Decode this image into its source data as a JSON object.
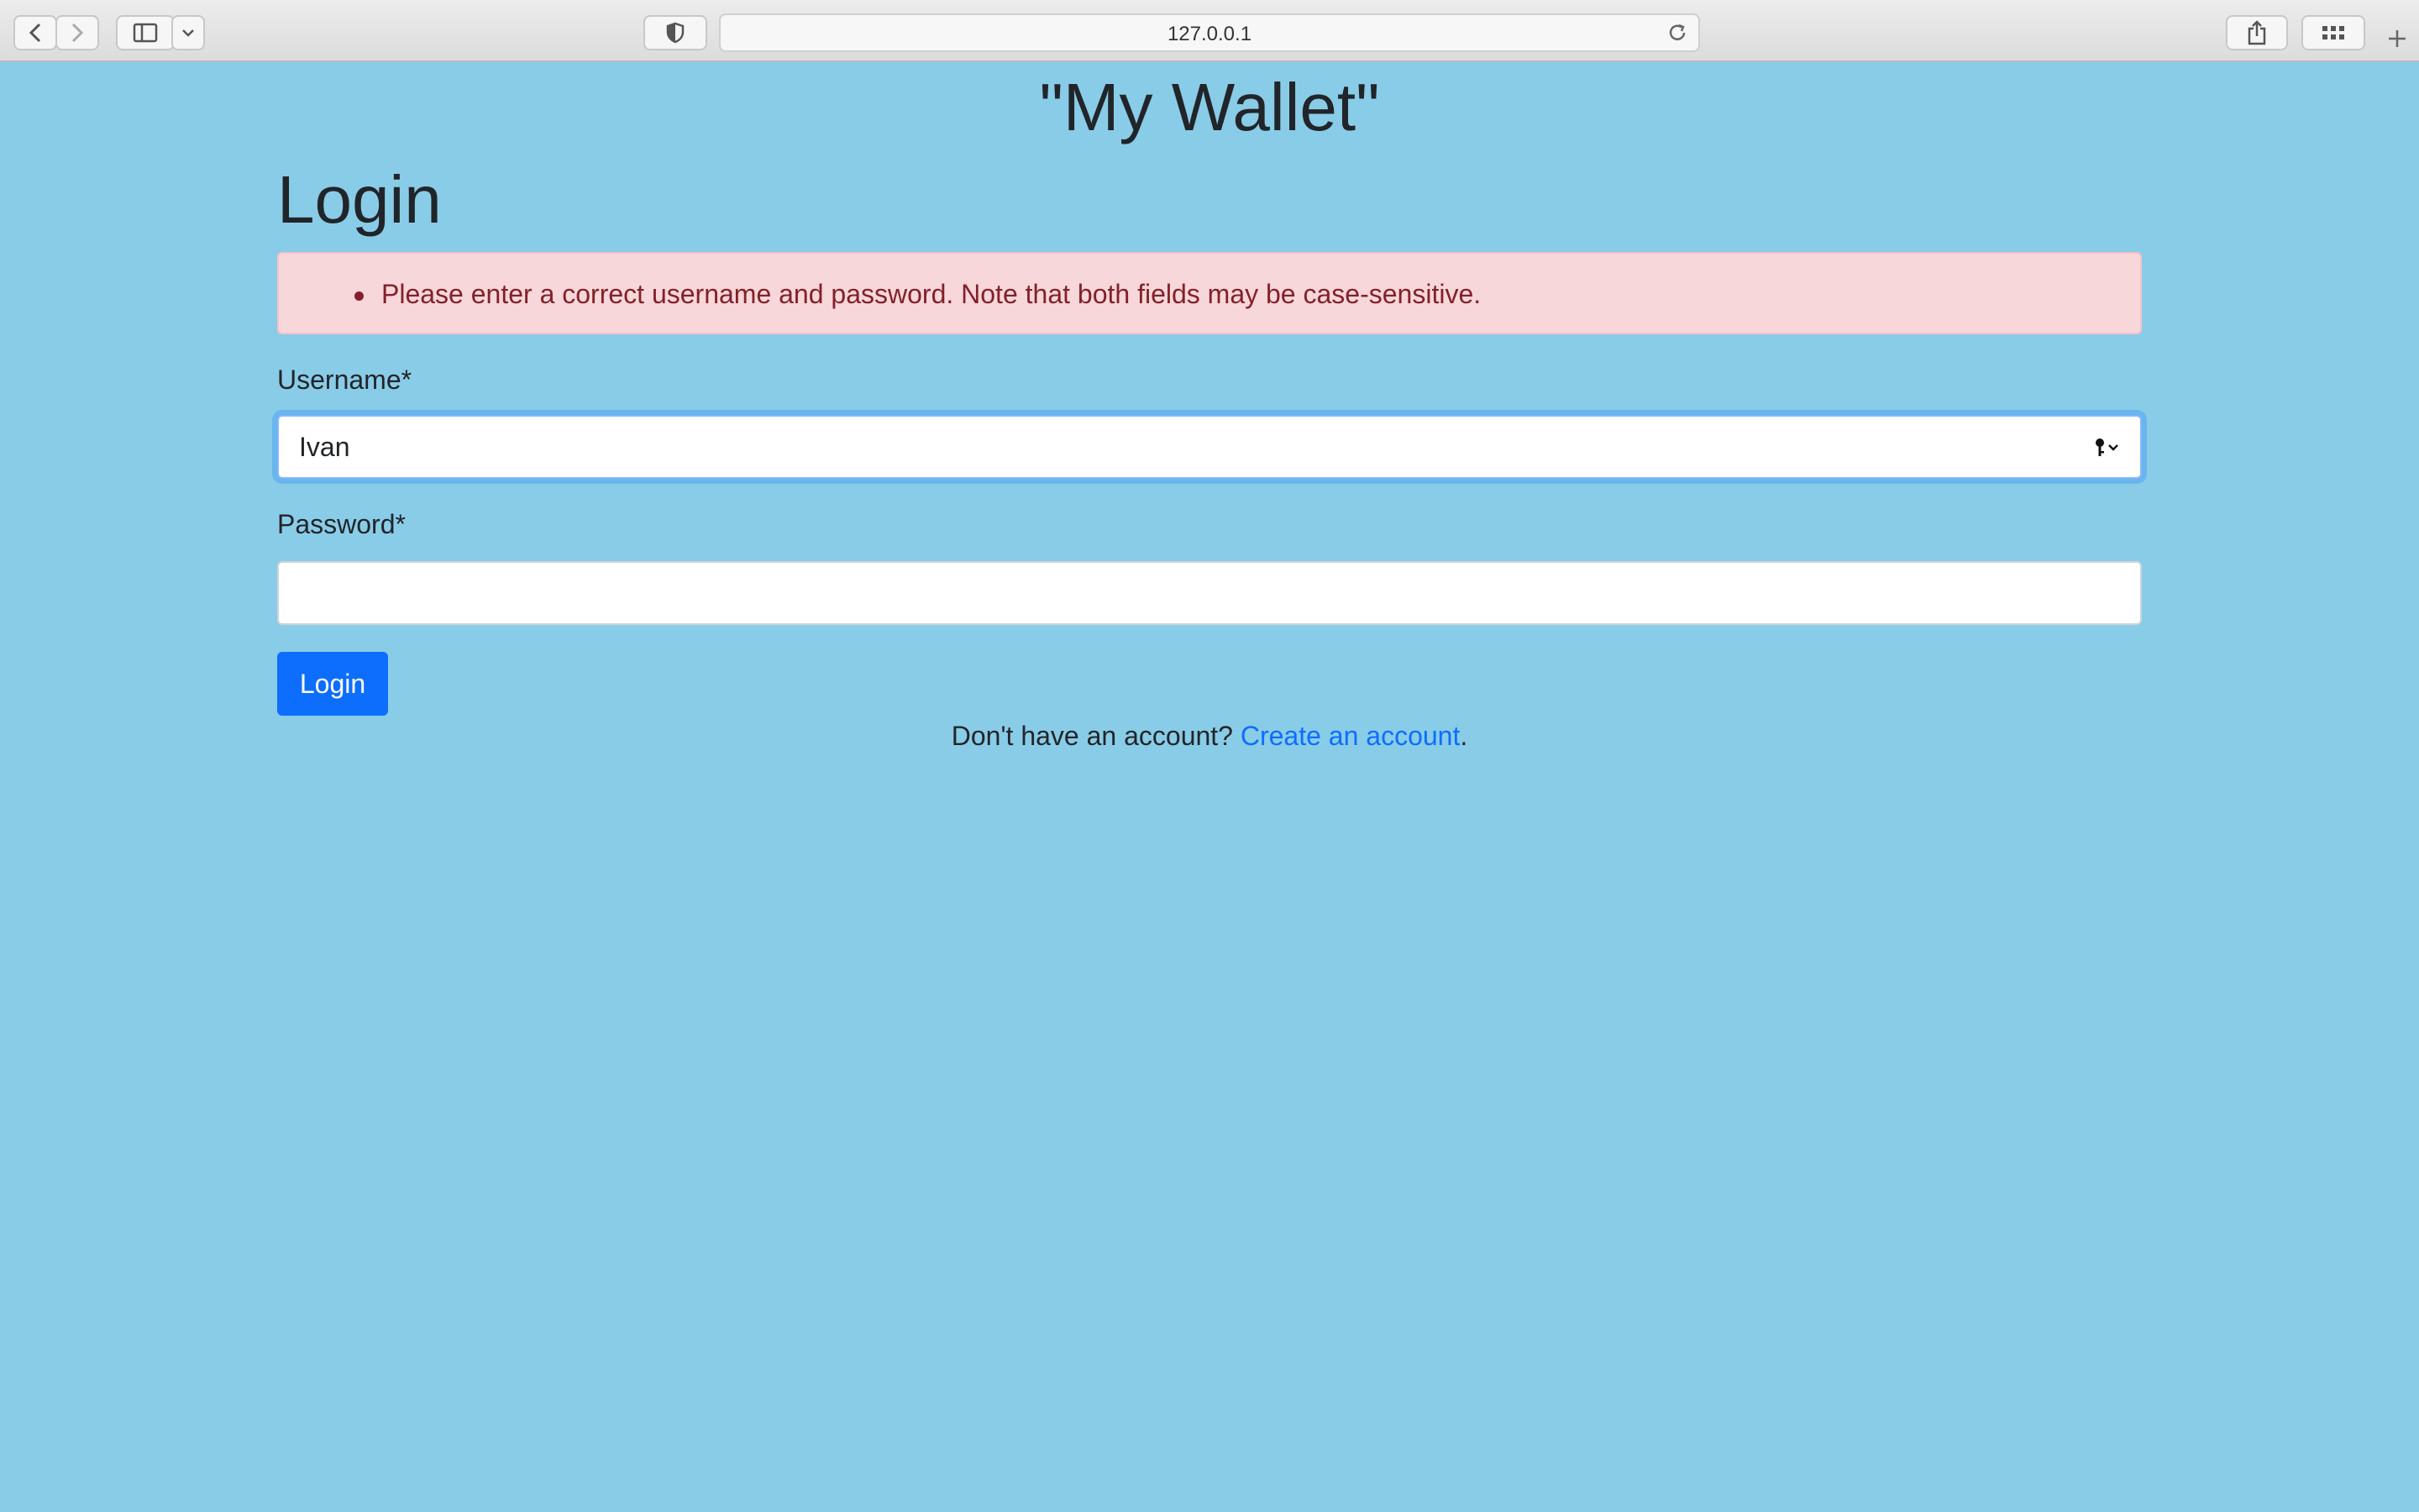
{
  "browser": {
    "url": "127.0.0.1",
    "icons": [
      "back-icon",
      "forward-icon",
      "sidebar-icon",
      "chevron-down-icon",
      "shield-icon",
      "reload-icon",
      "share-icon",
      "tabs-grid-icon",
      "plus-icon"
    ]
  },
  "page": {
    "brand": "\"My Wallet\"",
    "heading": "Login",
    "errors": [
      "Please enter a correct username and password. Note that both fields may be case-sensitive."
    ],
    "form": {
      "username_label": "Username*",
      "username_value": "Ivan",
      "password_label": "Password*",
      "password_value": "",
      "submit_label": "Login"
    },
    "signup": {
      "prompt": "Don't have an account?",
      "link": "Create an account",
      "suffix": "."
    }
  },
  "colors": {
    "page_background": "#89cce8",
    "primary": "#0d6efd",
    "alert_background": "#f8d7da",
    "alert_text": "#842029"
  }
}
